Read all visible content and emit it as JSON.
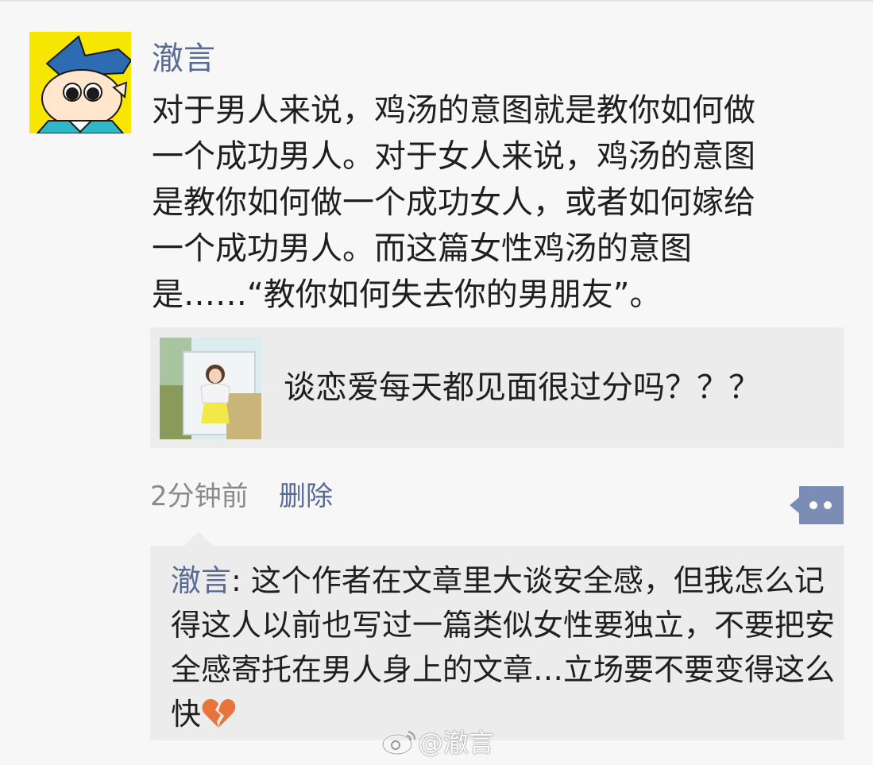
{
  "post": {
    "author": "澈言",
    "text": "对于男人来说，鸡汤的意图就是教你如何做\n一个成功男人。对于女人来说，鸡汤的意图\n是教你如何做一个成功女人，或者如何嫁给\n一个成功男人。而这篇女性鸡汤的意图\n是……“教你如何失去你的男朋友”。"
  },
  "link_card": {
    "title": "谈恋爱每天都见面很过分吗？？？"
  },
  "meta": {
    "time": "2分钟前",
    "delete_label": "删除"
  },
  "comment": {
    "author": "澈言",
    "separator": ": ",
    "text": "这个作者在文章里大谈安全感，但我怎么记得这人以前也写过一篇类似女性要独立，不要把安全感寄托在男人身上的文章…立场要不要变得这么快"
  },
  "watermark": {
    "text": "@澈言"
  },
  "colors": {
    "link_blue": "#576b95",
    "background": "#f7f7f7",
    "card_gray": "#ececec",
    "avatar_yellow": "#f6e600"
  }
}
